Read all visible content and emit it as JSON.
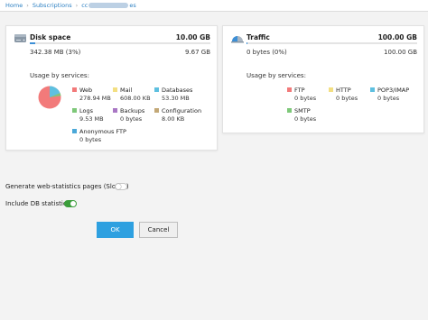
{
  "breadcrumb": {
    "items": [
      "Home",
      "Subscriptions",
      "cc",
      "es"
    ]
  },
  "disk": {
    "title": "Disk space",
    "total": "10.00 GB",
    "used": "342.38 MB (3%)",
    "free": "9.67 GB",
    "usage_fraction": 0.03,
    "usage_label": "Usage by services:",
    "services": [
      {
        "name": "Web",
        "value": "278.94 MB",
        "color": "#f27a7a"
      },
      {
        "name": "Mail",
        "value": "608.00 KB",
        "color": "#f3df82"
      },
      {
        "name": "Databases",
        "value": "53.30 MB",
        "color": "#5ec0e0"
      },
      {
        "name": "Logs",
        "value": "9.53 MB",
        "color": "#7ec879"
      },
      {
        "name": "Backups",
        "value": "0 bytes",
        "color": "#a977c4"
      },
      {
        "name": "Configuration",
        "value": "8.00 KB",
        "color": "#c3a877"
      },
      {
        "name": "Anonymous FTP",
        "value": "0 bytes",
        "color": "#4aa8d8"
      }
    ]
  },
  "traffic": {
    "title": "Traffic",
    "total": "100.00 GB",
    "used": "0 bytes (0%)",
    "free": "100.00 GB",
    "usage_fraction": 0,
    "usage_label": "Usage by services:",
    "services": [
      {
        "name": "FTP",
        "value": "0 bytes",
        "color": "#f27a7a"
      },
      {
        "name": "HTTP",
        "value": "0 bytes",
        "color": "#f3df82"
      },
      {
        "name": "POP3/IMAP",
        "value": "0 bytes",
        "color": "#5ec0e0"
      },
      {
        "name": "SMTP",
        "value": "0 bytes",
        "color": "#7ec879"
      }
    ]
  },
  "options": {
    "web_stats_label": "Generate web-statistics pages (Slowly)",
    "web_stats_on": false,
    "db_stat_label": "Include DB statistic",
    "db_stat_on": true
  },
  "buttons": {
    "ok_label": "OK",
    "cancel_label": "Cancel"
  },
  "colors": {
    "accent": "#2ea0e0",
    "toggle_on": "#3a9d3a",
    "link": "#2b7fc2"
  },
  "icons": {
    "disk": "hard-drive-icon",
    "traffic": "traffic-gauge-icon",
    "separator": "chevron-right-icon"
  }
}
